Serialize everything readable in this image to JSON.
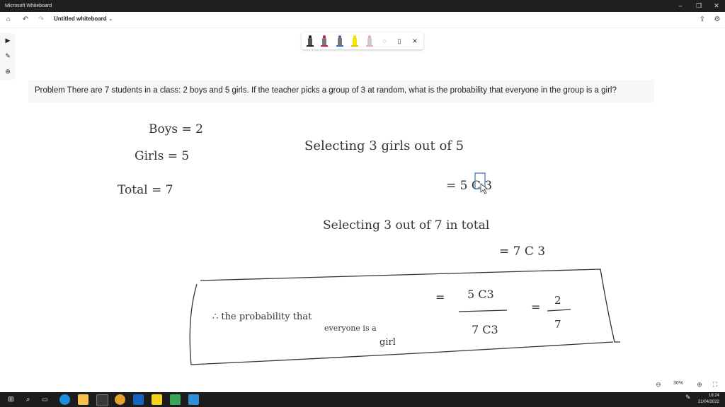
{
  "window": {
    "title": "Microsoft Whiteboard"
  },
  "appbar": {
    "doc_title": "Untitled whiteboard"
  },
  "problem": {
    "text": "Problem There are 7 students in a class: 2 boys and 5 girls. If the teacher picks a group of 3 at random, what is the probability that everyone in the group is a girl?"
  },
  "ink": {
    "boys": "Boys = 2",
    "girls": "Girls = 5",
    "total": "Total = 7",
    "select_girls": "Selecting 3 girls out of 5",
    "eq1": "= 5 C 3",
    "select_total": "Selecting 3 out of 7 in total",
    "eq2": "= 7 C 3",
    "prob_line1": "∴ the probability that",
    "prob_line2": "everyone is a",
    "prob_line3": "girl",
    "frac_num": "5 C3",
    "frac_den": "7 C3",
    "eq_sign": "=",
    "result_num": "2",
    "result_den": "7"
  },
  "zoom": {
    "level": "30%"
  },
  "clock": {
    "time": "18:24",
    "date": "21/04/2022"
  },
  "pens": [
    {
      "name": "black-pen",
      "color": "#222222"
    },
    {
      "name": "red-pen",
      "color": "#c0234b"
    },
    {
      "name": "blue-pen",
      "color": "#3e6fb5"
    },
    {
      "name": "yellow-highlighter",
      "color": "#f4e400"
    },
    {
      "name": "pink-highlighter",
      "color": "#f2a6b5"
    }
  ]
}
